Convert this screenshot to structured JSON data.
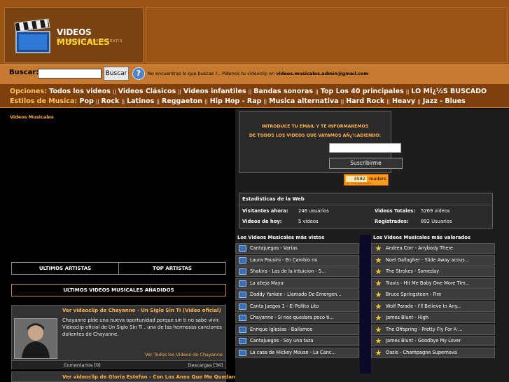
{
  "header": {
    "logo_title_1": "VIDEOS",
    "logo_title_2": "MUSICALES",
    "logo_subtitle": "LOS MEJORES VIDEOS GRATIS"
  },
  "search": {
    "label": "Buscar:",
    "button": "Buscar",
    "help_icon": "?",
    "note_prefix": "No encuentras lo que buscas ?.. Pidenos tu videoclip en",
    "note_email": "videos.musicales.admin@gmail.com"
  },
  "options": {
    "label": "Opciones:",
    "links": [
      "Todos los videos",
      "Videos Clásicos",
      "Videos infantiles",
      "Bandas sonoras",
      "Top Los 40 principales",
      "LO MÍ¿½S BUSCADO"
    ],
    "sep": "||"
  },
  "styles": {
    "label": "Estilos de Musica:",
    "links": [
      "Pop",
      "Rock",
      "Latinos",
      "Reggaeton",
      "Hip Hop - Rap",
      "Musica alternativa",
      "Hard Rock",
      "Heavy",
      "Jazz - Blues"
    ]
  },
  "left": {
    "section_label": "Videos Musicales",
    "tabs": [
      "ULTIMOS ARTISTAS",
      "TOP ARTISTAS"
    ],
    "added_title": "ULTIMOS VIDEOS MUSICALES AÑADIDOS",
    "cards": [
      {
        "title": "Ver videoclip de Chayanne - Un Siglo Sin Ti (Video oficial)",
        "desc": "Chayanne pide una nueva oportunidad porque sin ti no sabe vivir. Videoclip oficial de Un Siglo Sin Ti . una de las hermosas canciones dolientes de Chayanne.",
        "more": "Ver Todos los Videos de Chayanne",
        "comments": "Comentarios [0]",
        "downloads": "Descargas [36]"
      },
      {
        "title": "Ver videoclip de Gloria Estefan - Con Los Anos Que Me Quedan"
      }
    ]
  },
  "right": {
    "subscribe_line1": "INTRODUCE TU EMAIL Y TE INFORMAREMOS",
    "subscribe_line2": "DE TODOS LOS VIDEOS QUE VAYAMOS AÑ¿½ADIENDO:",
    "subscribe_button": "Suscribirme",
    "readers_count": "3582",
    "readers_label": "readers",
    "readers_by": "BY FEEDBURNER",
    "stats": {
      "title": "Estadisticas de la Web",
      "visitantes_k": "Visitantes ahora:",
      "visitantes_v": "246 usuarios",
      "videos_hoy_k": "Videos de hoy:",
      "videos_hoy_v": "5 videos",
      "totales_k": "Videos Totales:",
      "totales_v": "5269 videos",
      "registrados_k": "Registrados:",
      "registrados_v": "892 Usuarios"
    },
    "most_viewed_title": "Los Videos Musicales más vistos",
    "top_rated_title": "Los Videos Musicales más valorados",
    "most_viewed": [
      "Cantajuegos - Varias",
      "Laura Pausini - En Cambio no",
      "Shakira - Las de la intuicion - S...",
      "La abeja Maya",
      "Daddy Yankee - Llamado De Emergen...",
      "Canta Juegos 1 - El Pollito Lito",
      "Chayanne - Si nos quedara poco ti...",
      "Enrique Iglesias - Bailamos",
      "Cantajuegos - Soy una taza",
      "La casa de Mickey Mouse - La Canc..."
    ],
    "top_rated": [
      "Andrea Corr - Anybody There",
      "Noel Gallagher - Slide Away acous...",
      "The Strokes - Someday",
      "Travis - Hit Me Baby One More Tim...",
      "Bruce Springsteen - Fire",
      "Wolf Parade - I'll Believe In Any...",
      "James Blunt - High",
      "The Offspring - Pretty Fly For A ...",
      "James Blunt - Goodbye My Lover",
      "Oasis - Champagne Supernova"
    ]
  }
}
